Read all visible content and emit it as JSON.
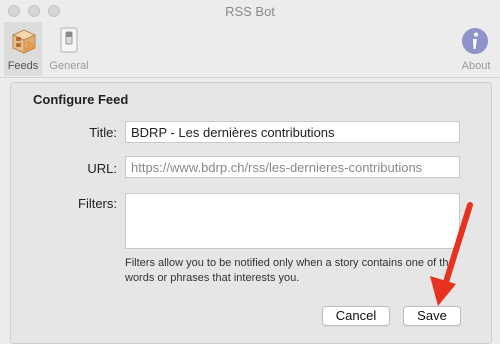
{
  "window": {
    "title": "RSS Bot"
  },
  "toolbar": {
    "feeds_label": "Feeds",
    "general_label": "General",
    "about_label": "About"
  },
  "form": {
    "section_title": "Configure Feed",
    "title_label": "Title:",
    "title_value": "BDRP - Les dernières contributions",
    "url_label": "URL:",
    "url_placeholder": "https://www.bdrp.ch/rss/les-dernieres-contributions",
    "filters_label": "Filters:",
    "filters_value": "",
    "help_text": "Filters allow you to be notified only when a story contains one of the words or phrases that interests you."
  },
  "buttons": {
    "cancel_label": "Cancel",
    "save_label": "Save"
  },
  "colors": {
    "arrow": "#e8321f",
    "about_icon": "#8e93c9"
  },
  "icons": {
    "feeds": "box-rss-icon",
    "general": "switch-icon",
    "about": "info-icon"
  }
}
